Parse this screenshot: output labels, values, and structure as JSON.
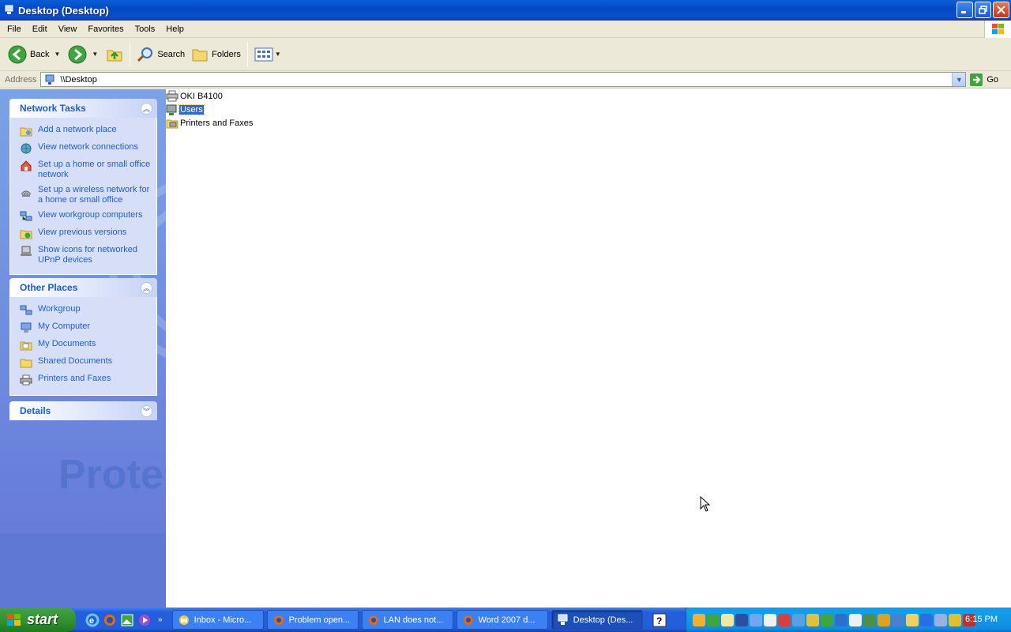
{
  "window": {
    "title": "Desktop (Desktop)"
  },
  "menu": [
    "File",
    "Edit",
    "View",
    "Favorites",
    "Tools",
    "Help"
  ],
  "toolbar": {
    "back_label": "Back",
    "search_label": "Search",
    "folders_label": "Folders"
  },
  "address": {
    "label": "Address",
    "value": "\\\\Desktop",
    "go_label": "Go"
  },
  "network_tasks": {
    "title": "Network Tasks",
    "items": [
      {
        "label": "Add a network place",
        "icon": "network-place-icon"
      },
      {
        "label": "View network connections",
        "icon": "network-connections-icon"
      },
      {
        "label": "Set up a home or small office network",
        "icon": "home-network-icon"
      },
      {
        "label": "Set up a wireless network for a home or small office",
        "icon": "wireless-icon"
      },
      {
        "label": "View workgroup computers",
        "icon": "workgroup-icon"
      },
      {
        "label": "View previous versions",
        "icon": "previous-versions-icon"
      },
      {
        "label": "Show icons for networked UPnP devices",
        "icon": "upnp-icon"
      }
    ]
  },
  "other_places": {
    "title": "Other Places",
    "items": [
      {
        "label": "Workgroup",
        "icon": "workgroup-icon"
      },
      {
        "label": "My Computer",
        "icon": "computer-icon"
      },
      {
        "label": "My Documents",
        "icon": "documents-icon"
      },
      {
        "label": "Shared Documents",
        "icon": "folder-icon"
      },
      {
        "label": "Printers and Faxes",
        "icon": "printer-icon"
      }
    ]
  },
  "details": {
    "title": "Details"
  },
  "pane_watermark": "Prote",
  "files": [
    {
      "name": "OKI B4100",
      "icon": "printer-share-icon",
      "selected": false
    },
    {
      "name": "Users",
      "icon": "network-share-icon",
      "selected": true
    },
    {
      "name": "Printers and Faxes",
      "icon": "printer-folder-icon",
      "selected": false
    }
  ],
  "taskbar": {
    "start_label": "start",
    "buttons": [
      {
        "label": "Inbox - Micro...",
        "icon": "outlook-icon",
        "active": false
      },
      {
        "label": "Problem open...",
        "icon": "firefox-icon",
        "active": false
      },
      {
        "label": "LAN does not...",
        "icon": "firefox-icon",
        "active": false
      },
      {
        "label": "Word 2007 d...",
        "icon": "firefox-icon",
        "active": false
      },
      {
        "label": "Desktop (Des...",
        "icon": "network-folder-icon",
        "active": true
      }
    ],
    "clock": "6:15 PM"
  },
  "colors": {
    "accent": "#215dc6",
    "selection": "#316ac5",
    "titlebar": "#0a5fd8",
    "taskpane": "#7ba2e7"
  }
}
